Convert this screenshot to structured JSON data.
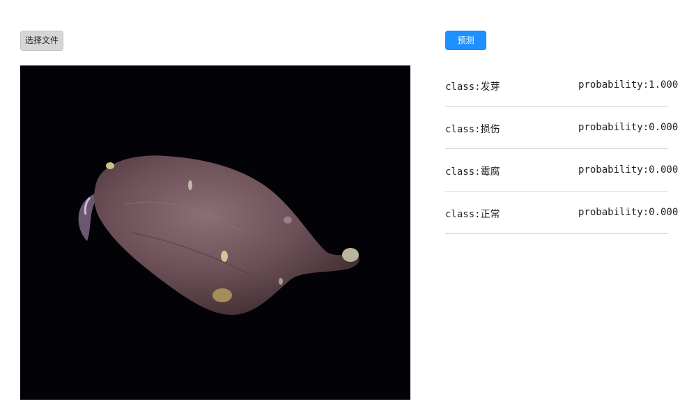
{
  "toolbar": {
    "choose_file_label": "选择文件",
    "predict_label": "预测"
  },
  "preview": {
    "image_subject": "sweet potato on black background"
  },
  "results": [
    {
      "class_text": "class:发芽",
      "probability_text": "probability:1.000"
    },
    {
      "class_text": "class:损伤",
      "probability_text": "probability:0.000"
    },
    {
      "class_text": "class:霉腐",
      "probability_text": "probability:0.000"
    },
    {
      "class_text": "class:正常",
      "probability_text": "probability:0.000"
    }
  ],
  "colors": {
    "predict_button": "#1e90ff",
    "file_button": "#d6d6d6",
    "image_background": "#030307",
    "divider": "#d6d6d6"
  }
}
